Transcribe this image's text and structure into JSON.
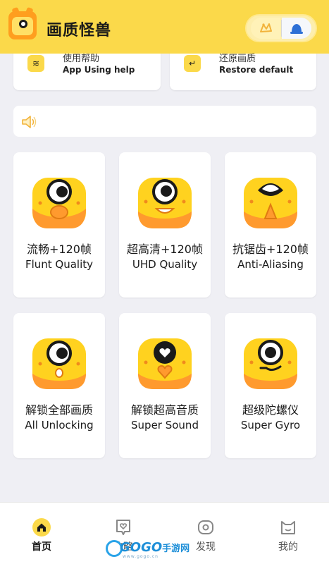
{
  "header": {
    "title": "画质怪兽",
    "logo_icon": "monster-logo-icon",
    "capsule_icons": [
      "gesture-icon",
      "bell-icon"
    ]
  },
  "help_cards": [
    {
      "title_cn": "使用帮助",
      "title_en": "App Using help",
      "icon": "layers-icon"
    },
    {
      "title_cn": "还原画质",
      "title_en": "Restore default",
      "icon": "restore-icon"
    }
  ],
  "notice": {
    "icon": "speaker-icon",
    "text": ""
  },
  "features": [
    {
      "cn": "流畅+120帧",
      "en": "Flunt Quality",
      "icon": "monster-surprised-icon"
    },
    {
      "cn": "超高清+120帧",
      "en": "UHD Quality",
      "icon": "monster-grin-icon"
    },
    {
      "cn": "抗锯齿+120帧",
      "en": "Anti-Aliasing",
      "icon": "monster-tongue-icon"
    },
    {
      "cn": "解锁全部画质",
      "en": "All Unlocking",
      "icon": "monster-oh-icon"
    },
    {
      "cn": "解锁超高音质",
      "en": "Super Sound",
      "icon": "monster-heart-icon"
    },
    {
      "cn": "超级陀螺仪",
      "en": "Super Gyro",
      "icon": "monster-smirk-icon"
    }
  ],
  "tabs": [
    {
      "label": "首页",
      "icon": "home-icon",
      "active": true
    },
    {
      "label": "攻略",
      "icon": "heart-chat-icon",
      "active": false
    },
    {
      "label": "发现",
      "icon": "discover-icon",
      "active": false
    },
    {
      "label": "我的",
      "icon": "cat-profile-icon",
      "active": false
    }
  ],
  "watermark": {
    "brand": "GOGO",
    "brand_cn": "手游网",
    "site": "www.gogo.cn"
  },
  "colors": {
    "accent": "#fbd94a",
    "monster_yellow": "#ffd21f",
    "monster_orange": "#ff9a2e"
  }
}
